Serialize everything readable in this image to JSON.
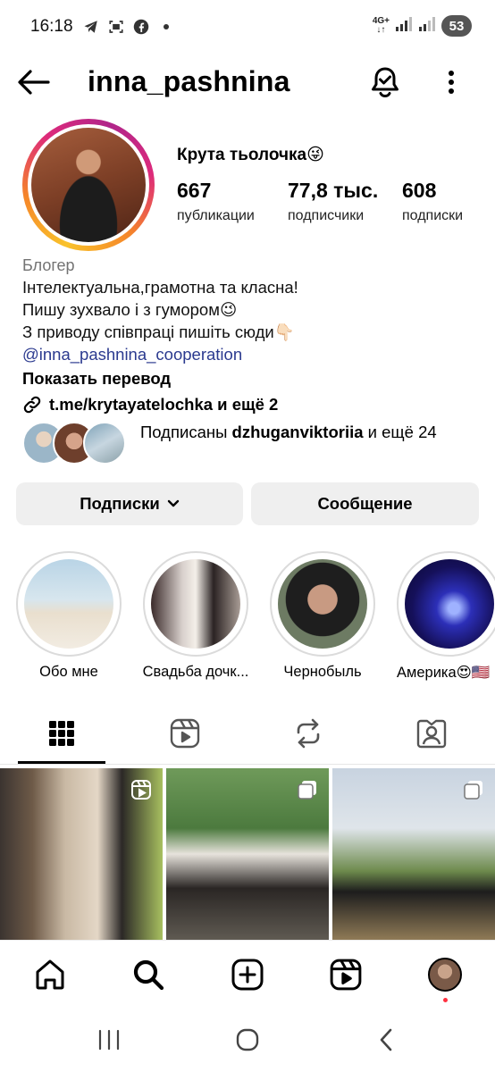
{
  "status_bar": {
    "time": "16:18",
    "network": "4G+",
    "battery": "53"
  },
  "header": {
    "username": "inna_pashnina"
  },
  "profile": {
    "display_name": "Крута тьолочка😜",
    "stats": [
      {
        "value": "667",
        "label": "публикации"
      },
      {
        "value": "77,8 тыс.",
        "label": "подписчики"
      },
      {
        "value": "608",
        "label": "подписки"
      }
    ],
    "category": "Блогер",
    "bio_lines": [
      "Інтелектуальна,грамотна та класна!",
      "Пишу зухвало і з гумором😉",
      "З приводу співпраці пишіть сюди👇🏻"
    ],
    "bio_mention": "@inna_pashnina_cooperation",
    "show_translation": "Показать перевод",
    "link": "t.me/krytayatelochka и ещё 2",
    "followed_by_prefix": "Подписаны ",
    "followed_by_name": "dzhuganviktoriia",
    "followed_by_suffix": " и ещё 24"
  },
  "actions": {
    "following": "Подписки",
    "message": "Сообщение"
  },
  "highlights": [
    {
      "label": "Обо мне"
    },
    {
      "label": "Свадьба дочк..."
    },
    {
      "label": "Чернобыль"
    },
    {
      "label": "Америка😍🇺🇸"
    }
  ],
  "tabs": [
    "grid-icon",
    "reels-icon",
    "reposts-icon",
    "tagged-icon"
  ],
  "colors": {
    "link": "#2b3a8f",
    "button_bg": "#efefef",
    "notification_dot": "#ff3040"
  }
}
